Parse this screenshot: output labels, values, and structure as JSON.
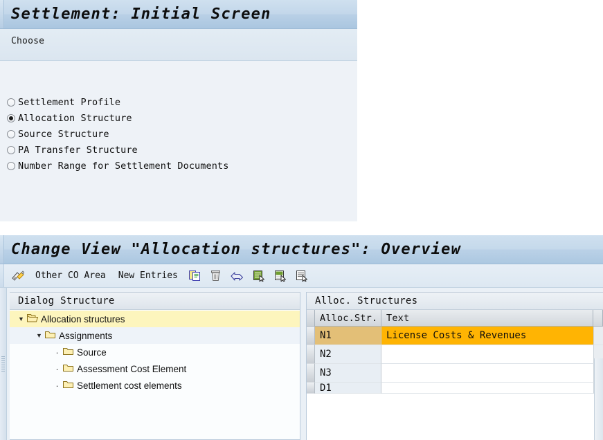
{
  "window_initial": {
    "title": "Settlement: Initial Screen",
    "choose_label": "Choose",
    "radio_group_name": "settlement-object",
    "options": [
      {
        "label": "Settlement Profile",
        "selected": false
      },
      {
        "label": "Allocation Structure",
        "selected": true
      },
      {
        "label": "Source Structure",
        "selected": false
      },
      {
        "label": "PA Transfer Structure",
        "selected": false
      },
      {
        "label": "Number Range for Settlement Documents",
        "selected": false
      }
    ]
  },
  "window_overview": {
    "title": "Change View \"Allocation structures\": Overview",
    "toolbar": {
      "display_change_icon": "pencil-display-change-icon",
      "other_co_area_label": "Other CO Area",
      "new_entries_label": "New Entries",
      "copy_icon": "copy-icon",
      "delete_icon": "delete-trash-icon",
      "undo_icon": "undo-icon",
      "select_all_icon": "select-all-detail-icon",
      "select_block_icon": "select-block-detail-icon",
      "details_icon": "details-list-icon"
    },
    "tree": {
      "header": "Dialog Structure",
      "nodes": [
        {
          "label": "Allocation structures",
          "level": 0,
          "icon": "folder-open-icon",
          "expanded": true,
          "selected": true
        },
        {
          "label": "Assignments",
          "level": 1,
          "icon": "folder-icon",
          "expanded": true,
          "selected": false
        },
        {
          "label": "Source",
          "level": 2,
          "icon": "folder-icon",
          "expanded": false,
          "selected": false
        },
        {
          "label": "Assessment Cost Element",
          "level": 2,
          "icon": "folder-icon",
          "expanded": false,
          "selected": false
        },
        {
          "label": "Settlement cost elements",
          "level": 2,
          "icon": "folder-icon",
          "expanded": false,
          "selected": false
        }
      ]
    },
    "table": {
      "caption": "Alloc. Structures",
      "columns": [
        "Alloc.Str.",
        "Text"
      ],
      "rows": [
        {
          "key": "N1",
          "text": "License Costs & Revenues",
          "selected": true
        },
        {
          "key": "N2",
          "text": "",
          "selected": false
        },
        {
          "key": "N3",
          "text": "",
          "selected": false
        },
        {
          "key": "D1",
          "text": "",
          "selected": false
        }
      ]
    }
  },
  "colors": {
    "title_bar": "#bad1e7",
    "tree_selection": "#fdf5bd",
    "row_selected_key": "#e3bf77",
    "row_selected_text": "#ffb403",
    "folder_yellow": "#f7e9a8"
  }
}
